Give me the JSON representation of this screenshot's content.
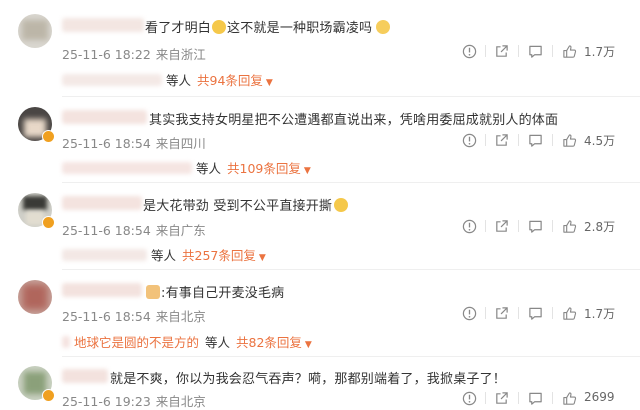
{
  "icons": [
    "info-icon",
    "share-icon",
    "comment-icon",
    "like-icon",
    "emoji-icon",
    "avatar-badge-icon"
  ],
  "colors": {
    "accent": "#eb7340",
    "meta": "#888888",
    "text": "#333333"
  },
  "comments": [
    {
      "text_a": "看了才明白",
      "text_b": "这不就是一种职场霸凌吗",
      "date": "25-11-6 18:22",
      "location": "来自浙江",
      "likes": "1.7万",
      "reply_suffix": "等人",
      "reply_count": "共94条回复"
    },
    {
      "text": "其实我支持女明星把不公遭遇都直说出来，凭啥用委屈成就别人的体面",
      "date": "25-11-6 18:54",
      "location": "来自四川",
      "likes": "4.5万",
      "reply_suffix": "等人",
      "reply_count": "共109条回复"
    },
    {
      "text": "是大花带劲 受到不公平直接开撕",
      "date": "25-11-6 18:54",
      "location": "来自广东",
      "likes": "2.8万",
      "reply_suffix": "等人",
      "reply_count": "共257条回复"
    },
    {
      "text": ":有事自己开麦没毛病",
      "date": "25-11-6 18:54",
      "location": "来自北京",
      "likes": "1.7万",
      "reply_name": "地球它是圆的不是方的",
      "reply_suffix": "等人",
      "reply_count": "共82条回复"
    },
    {
      "text": "就是不爽，你以为我会忍气吞声？嗬，那都别端着了，我掀桌子了！",
      "date": "25-11-6 19:23",
      "location": "来自北京",
      "likes": "2699"
    }
  ]
}
